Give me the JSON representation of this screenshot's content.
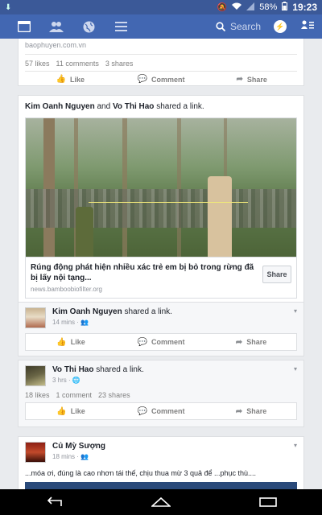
{
  "status": {
    "battery": "58%",
    "time": "19:23"
  },
  "nav": {
    "search_placeholder": "Search"
  },
  "top_card": {
    "domain": "baophuyen.com.vn",
    "likes": "57 likes",
    "comments": "11 comments",
    "shares": "3 shares",
    "like_label": "Like",
    "comment_label": "Comment",
    "share_label": "Share"
  },
  "story": {
    "name1": "Kim Oanh Nguyen",
    "connector": "and",
    "name2": "Vo Thi Hao",
    "action": "shared a link.",
    "link_title": "Rúng động phát hiện nhiều xác trẻ em bị bỏ trong rừng đã bị lấy nội tạng...",
    "link_domain": "news.bamboobiofilter.org",
    "share_button": "Share"
  },
  "sub1": {
    "name": "Kim Oanh Nguyen",
    "action": "shared a link.",
    "time": "14 mins",
    "like_label": "Like",
    "comment_label": "Comment",
    "share_label": "Share"
  },
  "sub2": {
    "name": "Vo Thi Hao",
    "action": "shared a link.",
    "time": "3 hrs",
    "likes": "18 likes",
    "comments": "1 comment",
    "shares": "23 shares",
    "like_label": "Like",
    "comment_label": "Comment",
    "share_label": "Share"
  },
  "bottom_post": {
    "name": "Củ Mỳ Sượng",
    "time": "18 mins",
    "text": "...móa ơi, đúng là cao nhơn tái thế, chịu thua mừ 3 quả để ...phục thù...."
  },
  "colors": {
    "brand": "#3b5998",
    "nav": "#4267b2"
  }
}
